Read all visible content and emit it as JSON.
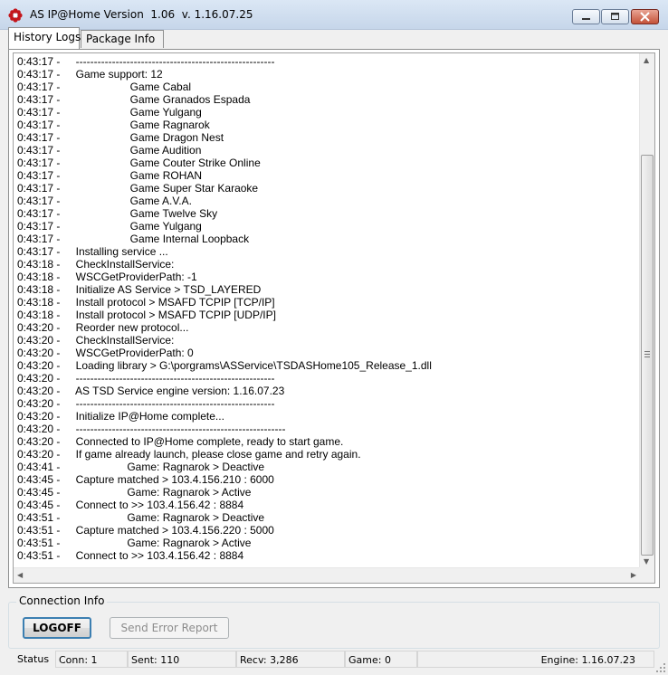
{
  "window": {
    "title": "AS IP@Home Version  1.06  v. 1.16.07.25",
    "app_icon": "flower-icon"
  },
  "tabs": [
    {
      "label": "History Logs",
      "active": true
    },
    {
      "label": "Package Info",
      "active": false
    }
  ],
  "log": [
    {
      "time": "0:43:17 -",
      "text": "  -------------------------------------------------------"
    },
    {
      "time": "0:43:17 -",
      "text": "  Game support: 12"
    },
    {
      "time": "0:43:17 -",
      "text": "                    Game Cabal"
    },
    {
      "time": "0:43:17 -",
      "text": "                    Game Granados Espada"
    },
    {
      "time": "0:43:17 -",
      "text": "                    Game Yulgang"
    },
    {
      "time": "0:43:17 -",
      "text": "                    Game Ragnarok"
    },
    {
      "time": "0:43:17 -",
      "text": "                    Game Dragon Nest"
    },
    {
      "time": "0:43:17 -",
      "text": "                    Game Audition"
    },
    {
      "time": "0:43:17 -",
      "text": "                    Game Couter Strike Online"
    },
    {
      "time": "0:43:17 -",
      "text": "                    Game ROHAN"
    },
    {
      "time": "0:43:17 -",
      "text": "                    Game Super Star Karaoke"
    },
    {
      "time": "0:43:17 -",
      "text": "                    Game A.V.A."
    },
    {
      "time": "0:43:17 -",
      "text": "                    Game Twelve Sky"
    },
    {
      "time": "0:43:17 -",
      "text": "                    Game Yulgang"
    },
    {
      "time": "0:43:17 -",
      "text": "                    Game Internal Loopback"
    },
    {
      "time": "0:43:17 -",
      "text": "  Installing service ..."
    },
    {
      "time": "0:43:18 -",
      "text": "  CheckInstallService:"
    },
    {
      "time": "0:43:18 -",
      "text": "  WSCGetProviderPath: -1"
    },
    {
      "time": "0:43:18 -",
      "text": "  Initialize AS Service > TSD_LAYERED"
    },
    {
      "time": "0:43:18 -",
      "text": "  Install protocol > MSAFD TCPIP [TCP/IP]"
    },
    {
      "time": "0:43:18 -",
      "text": "  Install protocol > MSAFD TCPIP [UDP/IP]"
    },
    {
      "time": "0:43:20 -",
      "text": "  Reorder new protocol..."
    },
    {
      "time": "0:43:20 -",
      "text": "  CheckInstallService:"
    },
    {
      "time": "0:43:20 -",
      "text": "  WSCGetProviderPath: 0"
    },
    {
      "time": "0:43:20 -",
      "text": "  Loading library > G:\\porgrams\\ASService\\TSDASHome105_Release_1.dll"
    },
    {
      "time": "0:43:20 -",
      "text": "  -------------------------------------------------------"
    },
    {
      "time": "0:43:20 -",
      "text": "  AS TSD Service engine version: 1.16.07.23"
    },
    {
      "time": "0:43:20 -",
      "text": "  -------------------------------------------------------"
    },
    {
      "time": "0:43:20 -",
      "text": "  Initialize IP@Home complete..."
    },
    {
      "time": "0:43:20 -",
      "text": "  ----------------------------------------------------------"
    },
    {
      "time": "0:43:20 -",
      "text": "  Connected to IP@Home complete, ready to start game."
    },
    {
      "time": "0:43:20 -",
      "text": "  If game already launch, please close game and retry again."
    },
    {
      "time": "0:43:41 -",
      "text": "                   Game: Ragnarok > Deactive"
    },
    {
      "time": "0:43:45 -",
      "text": "  Capture matched > 103.4.156.210 : 6000"
    },
    {
      "time": "0:43:45 -",
      "text": "                   Game: Ragnarok > Active"
    },
    {
      "time": "0:43:45 -",
      "text": "  Connect to >> 103.4.156.42 : 8884"
    },
    {
      "time": "0:43:51 -",
      "text": "                   Game: Ragnarok > Deactive"
    },
    {
      "time": "0:43:51 -",
      "text": "  Capture matched > 103.4.156.220 : 5000"
    },
    {
      "time": "0:43:51 -",
      "text": "                   Game: Ragnarok > Active"
    },
    {
      "time": "0:43:51 -",
      "text": "  Connect to >> 103.4.156.42 : 8884"
    }
  ],
  "connection": {
    "group_title": "Connection Info",
    "logoff_label": "LOGOFF",
    "send_error_label": "Send Error Report"
  },
  "status": {
    "label": "Status",
    "conn": "Conn: 1",
    "sent": "Sent: 110",
    "recv": "Recv: 3,286",
    "game": "Game: 0",
    "engine": "Engine: 1.16.07.23"
  }
}
